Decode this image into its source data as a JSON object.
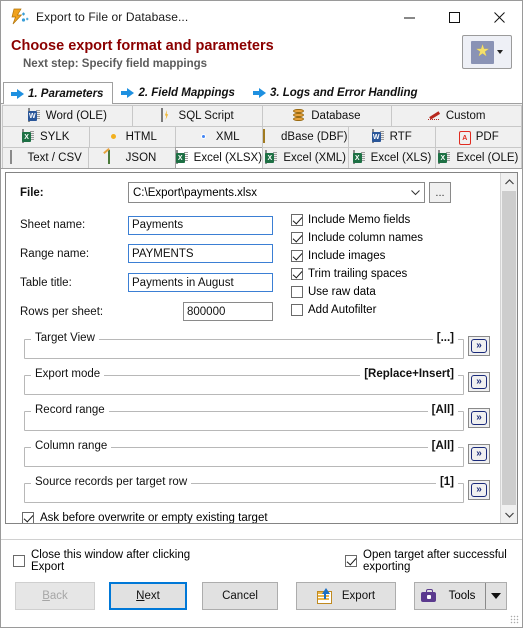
{
  "window": {
    "title": "Export to File or Database...",
    "app_icon": "export-lightning-icon",
    "minimize": "–",
    "maximize": "□",
    "close": "✕"
  },
  "header": {
    "heading": "Choose export format and parameters",
    "subheading": "Next step: Specify field mappings",
    "favorites_icon": "star-icon",
    "favorites_caret": "▼"
  },
  "wizard_tabs": [
    {
      "label": "1. Parameters",
      "icon": "blue-arrow-icon",
      "active": true
    },
    {
      "label": "2. Field Mappings",
      "icon": "blue-arrow-icon",
      "active": false
    },
    {
      "label": "3. Logs and Error Handling",
      "icon": "blue-arrow-icon",
      "active": false
    }
  ],
  "format_tabs": {
    "row1": [
      {
        "label": "Word (OLE)",
        "icon": "word-doc-icon",
        "selected": false
      },
      {
        "label": "SQL Script",
        "icon": "sql-script-icon",
        "selected": false
      },
      {
        "label": "Database",
        "icon": "database-cylinder-icon",
        "selected": false
      },
      {
        "label": "Custom",
        "icon": "pen-icon",
        "selected": false
      }
    ],
    "row2": [
      {
        "label": "SYLK",
        "icon": "excel-doc-icon",
        "selected": false
      },
      {
        "label": "HTML",
        "icon": "chrome-simple-icon",
        "selected": false
      },
      {
        "label": "XML",
        "icon": "chrome-icon",
        "selected": false
      },
      {
        "label": "dBase (DBF)",
        "icon": "table-grid-icon",
        "selected": false
      },
      {
        "label": "RTF",
        "icon": "word-doc-icon",
        "selected": false
      },
      {
        "label": "PDF",
        "icon": "pdf-icon",
        "selected": false
      }
    ],
    "row3": [
      {
        "label": "Text / CSV",
        "icon": "text-doc-icon",
        "selected": false
      },
      {
        "label": "JSON",
        "icon": "json-doc-icon",
        "selected": false
      },
      {
        "label": "Excel (XLSX)",
        "icon": "excel-doc-icon",
        "selected": true
      },
      {
        "label": "Excel (XML)",
        "icon": "excel-doc-icon",
        "selected": false
      },
      {
        "label": "Excel (XLS)",
        "icon": "excel-doc-icon",
        "selected": false
      },
      {
        "label": "Excel (OLE)",
        "icon": "excel-doc-icon",
        "selected": false
      }
    ]
  },
  "form": {
    "file_label": "File:",
    "file_value": "C:\\Export\\payments.xlsx",
    "file_caret": "⌄",
    "browse_label": "...",
    "sheet_label": "Sheet name:",
    "sheet_value": "Payments",
    "range_label": "Range name:",
    "range_value": "PAYMENTS",
    "table_title_label": "Table title:",
    "table_title_value": "Payments in August",
    "rows_label": "Rows per sheet:",
    "rows_value": "800000"
  },
  "options": [
    {
      "label": "Include Memo fields",
      "checked": true
    },
    {
      "label": "Include column names",
      "checked": true
    },
    {
      "label": "Include images",
      "checked": true
    },
    {
      "label": "Trim trailing spaces",
      "checked": true
    },
    {
      "label": "Use raw data",
      "checked": false
    },
    {
      "label": "Add Autofilter",
      "checked": false
    }
  ],
  "groups": [
    {
      "caption": "Target View",
      "value": "[...]",
      "button_icon": "double-chevron-right-icon"
    },
    {
      "caption": "Export mode",
      "value": "[Replace+Insert]",
      "button_icon": "double-chevron-right-icon"
    },
    {
      "caption": "Record range",
      "value": "[All]",
      "button_icon": "double-chevron-right-icon"
    },
    {
      "caption": "Column range",
      "value": "[All]",
      "button_icon": "double-chevron-right-icon"
    },
    {
      "caption": "Source records per target row",
      "value": "[1]",
      "button_icon": "double-chevron-right-icon"
    }
  ],
  "panel_last_check": {
    "label": "Ask before overwrite or empty existing target",
    "checked": true
  },
  "scrollbar": {
    "up": "⌃",
    "down": "⌄"
  },
  "bottom_checks": [
    {
      "label": "Close this window after clicking Export",
      "checked": false
    },
    {
      "label": "Open target after successful exporting",
      "checked": true
    }
  ],
  "buttons": {
    "back": {
      "pre": "",
      "accel": "B",
      "post": "ack",
      "disabled": true
    },
    "next": {
      "pre": "",
      "accel": "N",
      "post": "ext",
      "primary": true
    },
    "cancel": {
      "label": "Cancel"
    },
    "export": {
      "label": "Export",
      "icon": "export-sheet-up-arrow-icon"
    },
    "tools": {
      "label": "Tools",
      "icon": "toolbox-icon",
      "caret": "▼"
    }
  }
}
